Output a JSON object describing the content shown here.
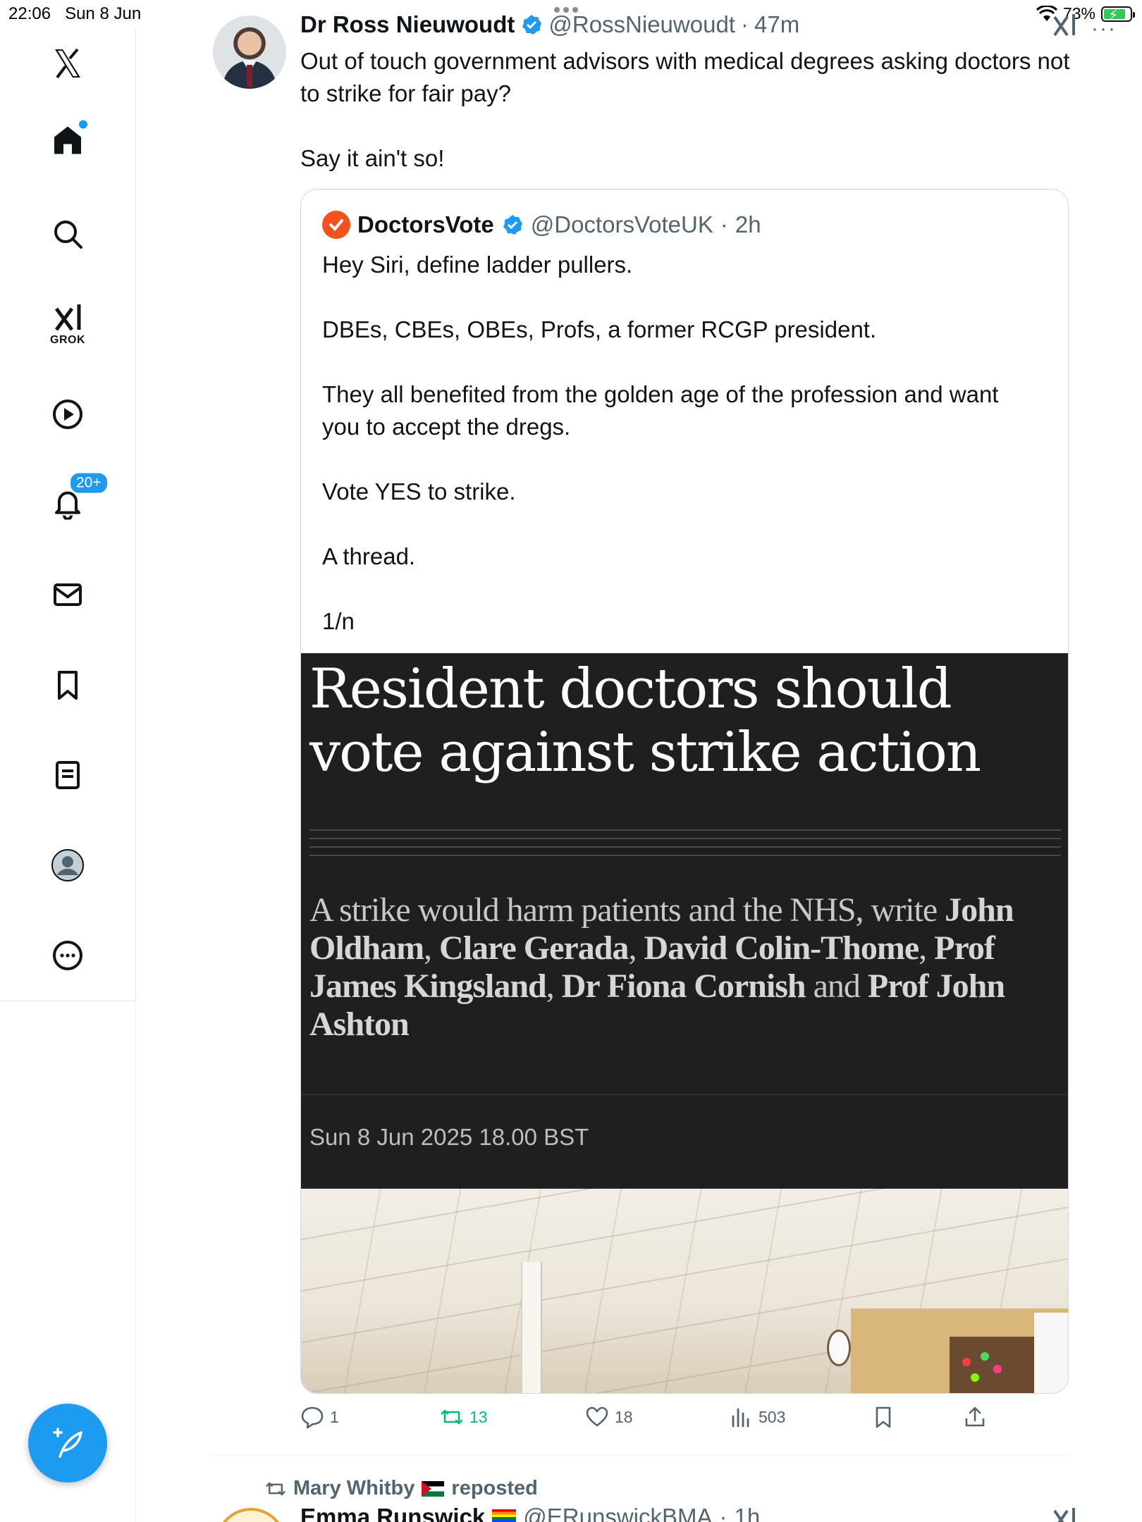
{
  "status_bar": {
    "time": "22:06",
    "date": "Sun 8 Jun",
    "battery": "73%"
  },
  "sidebar": {
    "grok_label": "GROK",
    "notifications_badge": "20+"
  },
  "tweet": {
    "author_name": "Dr Ross Nieuwoudt",
    "handle": "@RossNieuwoudt",
    "time": "47m",
    "text": "Out of touch government advisors with medical degrees asking doctors not to strike for fair pay?\n\nSay it ain't so!",
    "quote": {
      "author_name": "DoctorsVote",
      "handle": "@DoctorsVoteUK",
      "time": "2h",
      "text": "Hey Siri, define ladder pullers.\n\nDBEs, CBEs, OBEs, Profs, a former RCGP president.\n\nThey all benefited from the golden age of the profession and want you to accept the dregs.\n\nVote YES to strike.\n\nA thread.\n\n1/n",
      "article": {
        "headline": "Resident doctors should vote against strike action",
        "standfirst_lead": "A strike would harm patients and the NHS, write",
        "authors": [
          "John Oldham",
          "Clare Gerada",
          "David Colin-Thome",
          "Prof James Kingsland",
          "Dr Fiona Cornish",
          "Prof John Ashton"
        ],
        "and_word": "and",
        "date": "Sun 8 Jun 2025 18.00 BST"
      }
    },
    "actions": {
      "replies": "1",
      "reposts": "13",
      "likes": "18",
      "views": "503"
    }
  },
  "next_tweet": {
    "reposted_by": "Mary Whitby",
    "reposted_label": "reposted",
    "author_name": "Emma Runswick",
    "handle": "@ERunswickBMA",
    "time": "1h"
  },
  "colors": {
    "accent": "#1d9bf0",
    "repost_green": "#00ba7c",
    "muted": "#536471",
    "article_bg": "#1f1f1f",
    "doctorsvote_orange": "#f4511e"
  }
}
